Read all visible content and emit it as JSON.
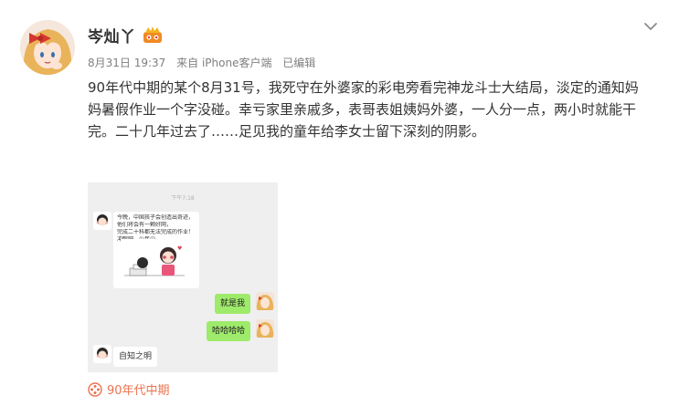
{
  "post": {
    "username": "岑灿丫",
    "meta": {
      "date": "8月31日 19:37",
      "source": "来自 iPhone客户端",
      "edited": "已编辑"
    },
    "text": "90年代中期的某个8月31号，我死守在外婆家的彩电旁看完神龙斗士大结局，淡定的通知妈妈暑假作业一个字没碰。幸亏家里亲戚多，表哥表姐姨妈外婆，一人分一点，两小时就能干完。二十几年过去了……足见我的童年给李女士留下深刻的阴影。",
    "topic": "90年代中期"
  },
  "chat": {
    "time": "下午7:18",
    "long_message_lines": [
      "今晚，中国孩子会创造出奇迹，",
      "他们将会有一颗好网，",
      "完成二十科都无法完成的作业！",
      "冲鸭吧，少年😀"
    ],
    "reply1": "就是我",
    "reply2": "哈哈哈哈",
    "reply3": "自知之明"
  },
  "colors": {
    "topic": "#eb7350",
    "green_bubble": "#9eea6a",
    "chat_background": "#efefef"
  },
  "icons": {
    "badge": "member-crown-icon",
    "chevron": "chevron-down-icon",
    "topic": "film-reel-icon"
  }
}
